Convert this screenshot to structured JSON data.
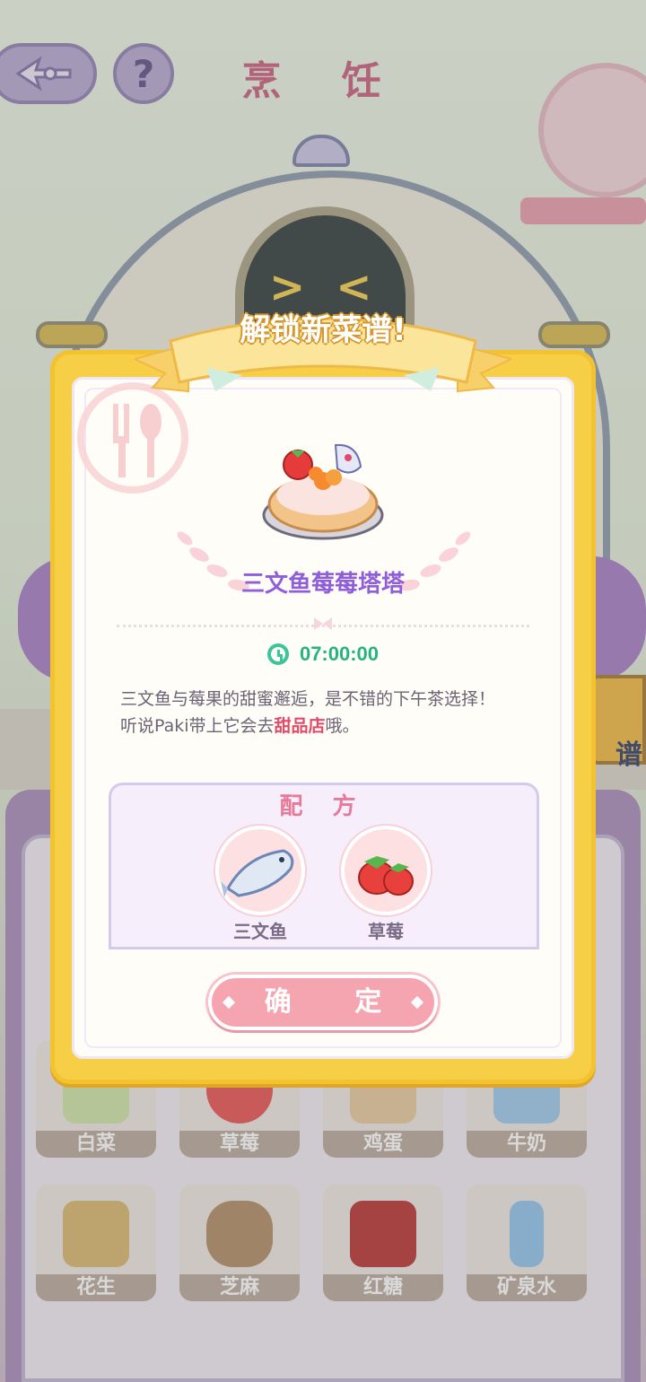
{
  "screen": {
    "title": "烹 饪",
    "recipe_book_label": "谱"
  },
  "ingredient_grid": [
    {
      "label": "白菜",
      "icon": "napa-cabbage-icon",
      "color": "#cfe3a6"
    },
    {
      "label": "草莓",
      "icon": "strawberry-icon",
      "color": "#e85050"
    },
    {
      "label": "鸡蛋",
      "icon": "egg-carton-icon",
      "color": "#e8c89a"
    },
    {
      "label": "牛奶",
      "icon": "milk-carton-icon",
      "color": "#9cc8ec"
    },
    {
      "label": "花生",
      "icon": "peanut-bag-icon",
      "color": "#d9b46a"
    },
    {
      "label": "芝麻",
      "icon": "sesame-sack-icon",
      "color": "#b08a62"
    },
    {
      "label": "红糖",
      "icon": "brown-sugar-icon",
      "color": "#b8302e"
    },
    {
      "label": "矿泉水",
      "icon": "water-bottle-icon",
      "color": "#8fc3ec"
    }
  ],
  "modal": {
    "banner": "解锁新菜谱!",
    "dish_name": "三文鱼莓莓塔塔",
    "dish_icon": "salmon-berry-tart-icon",
    "cook_time": "07:00:00",
    "desc_line1": "三文鱼与莓果的甜蜜邂逅，是不错的下午茶选择！",
    "desc_line2_pre": "听说Paki带上它会去",
    "desc_line2_highlight": "甜品店",
    "desc_line2_post": "哦。",
    "recipe_title": "配 方",
    "ingredients": [
      {
        "label": "三文鱼",
        "icon": "salmon-icon"
      },
      {
        "label": "草莓",
        "icon": "strawberry-icon"
      }
    ],
    "confirm_label": "确 定"
  },
  "colors": {
    "frame": "#f7cf46",
    "dish_name": "#8f5ed8",
    "timer": "#27b282",
    "highlight": "#e34a6a",
    "confirm": "#f5a5b0"
  }
}
